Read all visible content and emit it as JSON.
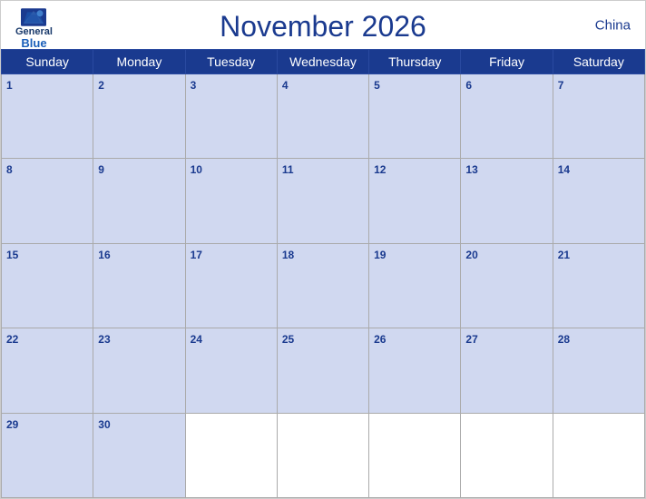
{
  "header": {
    "logo": {
      "general": "General",
      "blue": "Blue"
    },
    "title": "November 2026",
    "country": "China"
  },
  "weekdays": [
    "Sunday",
    "Monday",
    "Tuesday",
    "Wednesday",
    "Thursday",
    "Friday",
    "Saturday"
  ],
  "weeks": [
    [
      {
        "day": "1",
        "empty": false
      },
      {
        "day": "2",
        "empty": false
      },
      {
        "day": "3",
        "empty": false
      },
      {
        "day": "4",
        "empty": false
      },
      {
        "day": "5",
        "empty": false
      },
      {
        "day": "6",
        "empty": false
      },
      {
        "day": "7",
        "empty": false
      }
    ],
    [
      {
        "day": "8",
        "empty": false
      },
      {
        "day": "9",
        "empty": false
      },
      {
        "day": "10",
        "empty": false
      },
      {
        "day": "11",
        "empty": false
      },
      {
        "day": "12",
        "empty": false
      },
      {
        "day": "13",
        "empty": false
      },
      {
        "day": "14",
        "empty": false
      }
    ],
    [
      {
        "day": "15",
        "empty": false
      },
      {
        "day": "16",
        "empty": false
      },
      {
        "day": "17",
        "empty": false
      },
      {
        "day": "18",
        "empty": false
      },
      {
        "day": "19",
        "empty": false
      },
      {
        "day": "20",
        "empty": false
      },
      {
        "day": "21",
        "empty": false
      }
    ],
    [
      {
        "day": "22",
        "empty": false
      },
      {
        "day": "23",
        "empty": false
      },
      {
        "day": "24",
        "empty": false
      },
      {
        "day": "25",
        "empty": false
      },
      {
        "day": "26",
        "empty": false
      },
      {
        "day": "27",
        "empty": false
      },
      {
        "day": "28",
        "empty": false
      }
    ],
    [
      {
        "day": "29",
        "empty": false
      },
      {
        "day": "30",
        "empty": false
      },
      {
        "day": "",
        "empty": true
      },
      {
        "day": "",
        "empty": true
      },
      {
        "day": "",
        "empty": true
      },
      {
        "day": "",
        "empty": true
      },
      {
        "day": "",
        "empty": true
      }
    ]
  ],
  "colors": {
    "header_bg": "#1a3a8f",
    "row_header_bg": "#c8d4f0",
    "accent": "#1a3a8f"
  }
}
